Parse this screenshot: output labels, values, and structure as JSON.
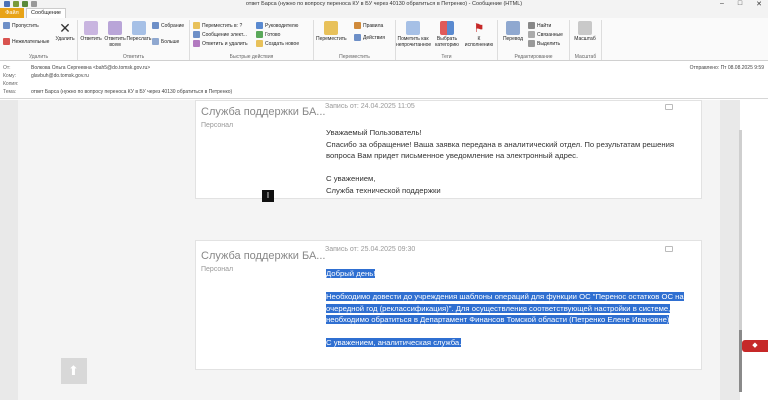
{
  "window": {
    "title": "ответ Барса (нужно по вопросу переноса КУ в БУ через 40130 обратиться в Петренко) - Сообщение (HTML)",
    "min": "–",
    "max": "□",
    "close": "✕"
  },
  "tabs": {
    "file": "Файл",
    "message": "Сообщение"
  },
  "ribbon": {
    "delete_group": {
      "label": "Удалить",
      "skip": "Пропустить",
      "junk": "Нежелательные",
      "delete": "Удалить"
    },
    "reply_group": {
      "label": "Ответить",
      "reply": "Ответить",
      "reply_all": "Ответить всем",
      "forward": "Переслать",
      "meeting": "Собрание",
      "more": "Больше"
    },
    "quick_group": {
      "label": "Быстрые действия",
      "move_to": "Переместить в: ?",
      "team": "Сообщение элект...",
      "reply_delete": "Ответить и удалить",
      "manager": "Руководителю",
      "done": "Готово",
      "create_new": "Создать новое"
    },
    "move_group": {
      "label": "Переместить",
      "move": "Переместить",
      "rules": "Правила",
      "actions": "Действия"
    },
    "tags_group": {
      "label": "Теги",
      "mark_unread": "Пометить как непрочитанное",
      "categorize": "Выбрать категорию",
      "followup": "К исполнению"
    },
    "edit_group": {
      "label": "Редактирование",
      "translate": "Перевод",
      "find": "Найти",
      "related": "Связанные",
      "select": "Выделить"
    },
    "zoom_group": {
      "label": "Масштаб",
      "zoom": "Масштаб"
    }
  },
  "header": {
    "from_label": "От:",
    "from": "Волкова Ольга Сергеевна <bah5@do.tomsk.gov.ru>",
    "to_label": "Кому:",
    "to": "glavbuh@do.tomsk.gov.ru",
    "cc_label": "Копия:",
    "cc": "",
    "subject_label": "Тема:",
    "subject": "ответ Барса (нужно по вопросу переноса КУ в БУ через 40130 обратиться в Петренко)",
    "sent": "Отправлено:  Пт 08.08.2025 9:59"
  },
  "messages": [
    {
      "author": "Служба поддержки БА...",
      "role": "Персонал",
      "record": "Запись от: 24.04.2025 11:05",
      "lines": [
        "Уважаемый Пользователь!",
        "Спасибо за обращение! Ваша заявка передана в аналитический отдел. По результатам решения",
        "вопроса Вам придет письменное уведомление на электронный адрес.",
        "",
        "С уважением,",
        "Служба технической поддержки"
      ]
    },
    {
      "author": "Служба поддержки БА...",
      "role": "Персонал",
      "record": "Запись от: 25.04.2025 09:30",
      "lines": [
        "Добрый день!",
        " ",
        "Необходимо довести до учреждения шаблоны операций для функции ОС \"Перенос остатков ОС на",
        "очередной год (реклассификация)\". Для осуществления соответствующей настройки в системе,",
        "необходимо обратиться в Департамент Финансов Томской области (Петренко Елене Ивановне)",
        " ",
        "С уважением, аналитическая служба."
      ]
    }
  ],
  "colors": {
    "file_tab": "#e8a317",
    "highlight": "#2f6fd1",
    "badge": "#c62828"
  }
}
